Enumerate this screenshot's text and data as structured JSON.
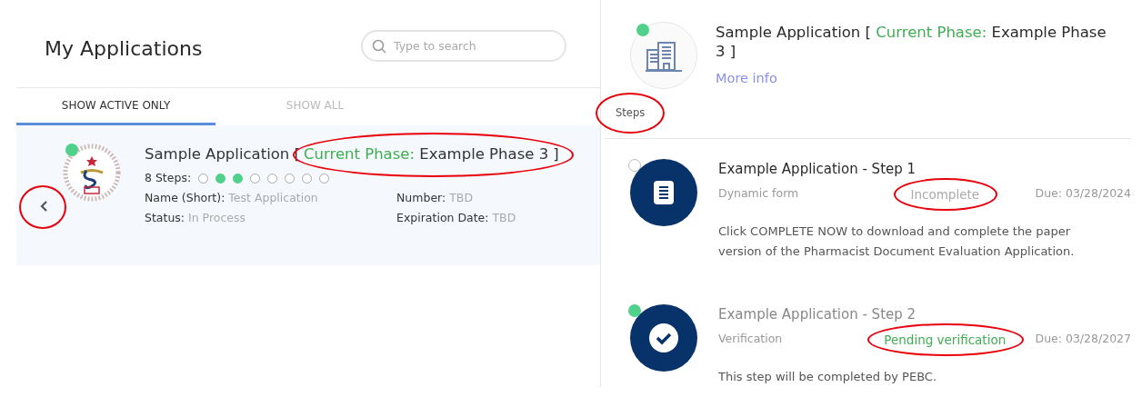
{
  "left_panel": {
    "title": "My Applications",
    "search": {
      "placeholder": "Type to search"
    },
    "tabs": [
      {
        "label": "SHOW ACTIVE ONLY",
        "selected": true
      },
      {
        "label": "SHOW ALL",
        "selected": false
      }
    ],
    "applications": [
      {
        "back_circled": true,
        "active": true,
        "name": "Sample Application [",
        "phase_label": "Current Phase:",
        "phase": "Example Phase 3 ]",
        "phase_circled": true,
        "steps_label": "8 Steps:",
        "steps": [
          {
            "completed": false
          },
          {
            "completed": true
          },
          {
            "completed": true
          },
          {
            "completed": false
          },
          {
            "completed": false
          },
          {
            "completed": false
          },
          {
            "completed": false
          },
          {
            "completed": false
          }
        ],
        "fields": [
          {
            "label": "Name (Short):",
            "value": "Test Application"
          },
          {
            "label": "Number:",
            "value": "TBD"
          },
          {
            "label": "Status:",
            "value": "In Process"
          },
          {
            "label": "Expiration Date:",
            "value": "TBD"
          }
        ]
      }
    ]
  },
  "right_panel": {
    "active": true,
    "title": "Sample Application [ **Current Phase:** Example Phase 3 ]",
    "more_info": "More info",
    "tab": {
      "label": "Steps",
      "circled": true
    },
    "steps": [
      {
        "kind": "form",
        "completed": false,
        "title": "Example Application - Step 1",
        "type": "Dynamic form",
        "status": "Incomplete",
        "pending": false,
        "status_circled": true,
        "due": "Due: 03/28/2024",
        "description": "Click COMPLETE NOW to download and complete the paper version of the Pharmacist Document Evaluation Application."
      },
      {
        "kind": "verification",
        "completed": true,
        "title": "Example Application - Step 2",
        "type": "Verification",
        "status": "Pending verification",
        "pending": true,
        "status_circled": true,
        "due": "Due: 03/28/2027",
        "description": "This step will be completed by PEBC."
      }
    ]
  }
}
